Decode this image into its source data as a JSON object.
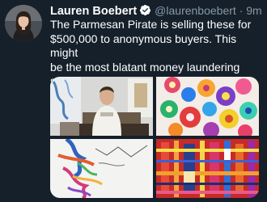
{
  "tweet": {
    "author_name": "Lauren Boebert",
    "handle": "@laurenboebert",
    "separator": "·",
    "time": "9m",
    "text": "The Parmesan Pirate is selling these for\n$500,000 to anonymous buyers. This might\nbe the most blatant money laundering\nscheme in recent history.",
    "verified": true
  },
  "colors": {
    "background": "#15202b",
    "text": "#ffffff",
    "secondary_text": "#8899a6",
    "verified_badge": "#ffffff"
  },
  "icons": {
    "verified": "verified-badge-icon"
  },
  "media": {
    "count": 4,
    "images": [
      "photo-man-in-studio",
      "colorful-abstract-painting",
      "abstract-figure-sketch-painting",
      "red-grid-abstract-painting"
    ]
  }
}
